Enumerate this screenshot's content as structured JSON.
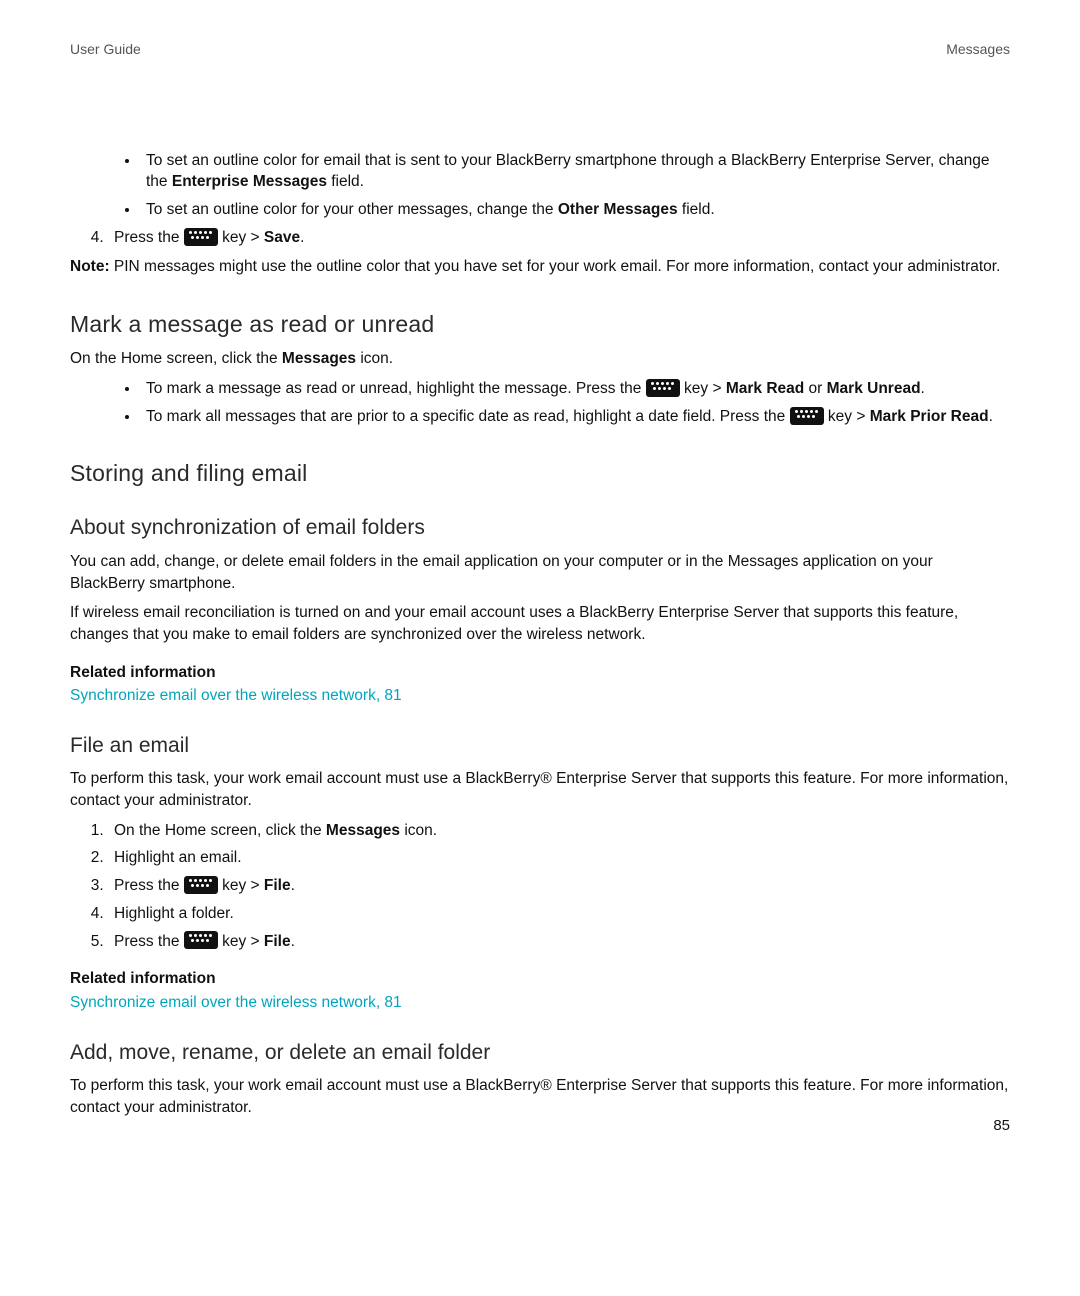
{
  "header": {
    "left": "User Guide",
    "right": "Messages"
  },
  "intro_bullets": [
    {
      "pre": "To set an outline color for email that is sent to your BlackBerry smartphone through a BlackBerry Enterprise Server, change the ",
      "bold": "Enterprise Messages",
      "post": " field."
    },
    {
      "pre": "To set an outline color for your other messages, change the ",
      "bold": "Other Messages",
      "post": " field."
    }
  ],
  "step4": {
    "num": "4.",
    "pre": "Press the ",
    "mid": " key > ",
    "bold": "Save",
    "post": "."
  },
  "note": {
    "label": "Note:",
    "text": " PIN messages might use the outline color that you have set for your work email. For more information, contact your administrator."
  },
  "sec_mark": {
    "title": "Mark a message as read or unread",
    "intro_pre": "On the Home screen, click the ",
    "intro_bold": "Messages",
    "intro_post": " icon.",
    "b1": {
      "pre": "To mark a message as read or unread, highlight the message. Press the ",
      "mid": " key > ",
      "bold1": "Mark Read",
      "or": " or ",
      "bold2": "Mark Unread",
      "post": "."
    },
    "b2": {
      "pre": "To mark all messages that are prior to a specific date as read, highlight a date field. Press the ",
      "mid": " key > ",
      "bold": "Mark Prior Read",
      "post": "."
    }
  },
  "sec_storing": {
    "title": "Storing and filing email"
  },
  "sec_about": {
    "title": "About synchronization of email folders",
    "p1": "You can add, change, or delete email folders in the email application on your computer or in the Messages application on your BlackBerry smartphone.",
    "p2": "If wireless email reconciliation is turned on and your email account uses a BlackBerry Enterprise Server that supports this feature, changes that you make to email folders are synchronized over the wireless network.",
    "related_head": "Related information",
    "related_link": "Synchronize email over the wireless network, 81"
  },
  "sec_file": {
    "title": "File an email",
    "p1": "To perform this task, your work email account must use a BlackBerry® Enterprise Server that supports this feature. For more information, contact your administrator.",
    "s1": {
      "pre": "On the Home screen, click the ",
      "bold": "Messages",
      "post": " icon."
    },
    "s2": "Highlight an email.",
    "s3": {
      "pre": "Press the ",
      "mid": " key > ",
      "bold": "File",
      "post": "."
    },
    "s4": "Highlight a folder.",
    "s5": {
      "pre": "Press the ",
      "mid": " key > ",
      "bold": "File",
      "post": "."
    },
    "related_head": "Related information",
    "related_link": "Synchronize email over the wireless network, 81"
  },
  "sec_addmove": {
    "title": "Add, move, rename, or delete an email folder",
    "p1": "To perform this task, your work email account must use a BlackBerry® Enterprise Server that supports this feature. For more information, contact your administrator."
  },
  "page_number": "85"
}
